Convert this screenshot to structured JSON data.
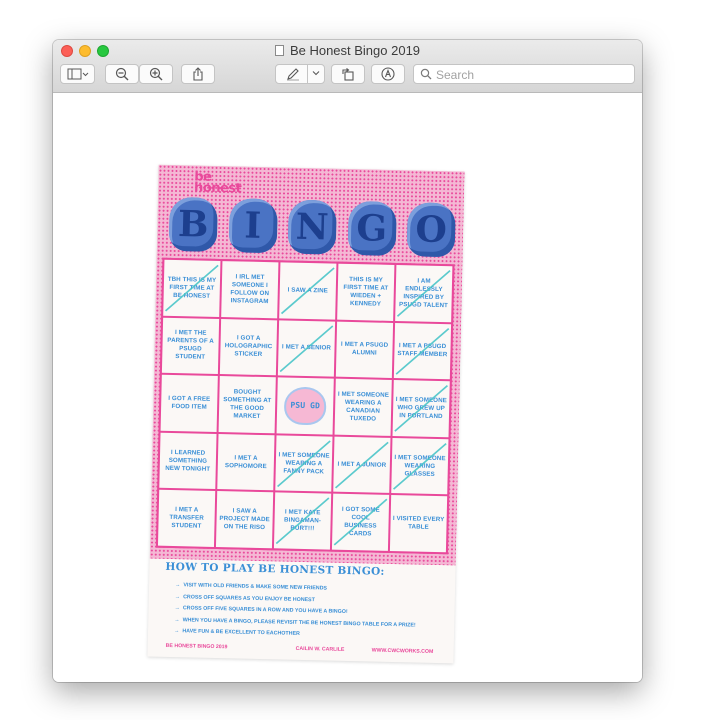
{
  "window": {
    "title": "Be Honest Bingo 2019"
  },
  "toolbar": {
    "sidebar_icon": "sidebar-icon",
    "zoom_out_icon": "zoom-out-icon",
    "zoom_in_icon": "zoom-in-icon",
    "share_icon": "share-icon",
    "markup_icon": "pen-icon",
    "rotate_icon": "rotate-icon",
    "annotate_icon": "markup-icon",
    "search_placeholder": "Search"
  },
  "card": {
    "brand_line1": "be",
    "brand_line2": "honest",
    "letters": [
      "B",
      "I",
      "N",
      "G",
      "O"
    ],
    "squares": [
      {
        "text": "TBH THIS IS MY FIRST TIME AT BE HONEST",
        "crossed": true
      },
      {
        "text": "I IRL MET SOMEONE I FOLLOW ON INSTAGRAM",
        "crossed": false
      },
      {
        "text": "I SAW A ZINE",
        "crossed": true
      },
      {
        "text": "THIS IS MY FIRST TIME AT WIEDEN + KENNEDY",
        "crossed": false
      },
      {
        "text": "I AM ENDLESSLY INSPIRED BY PSUGD TALENT",
        "crossed": true
      },
      {
        "text": "I MET THE PARENTS OF A PSUGD STUDENT",
        "crossed": false
      },
      {
        "text": "I GOT A HOLOGRAPHIC STICKER",
        "crossed": false
      },
      {
        "text": "I MET A SENIOR",
        "crossed": true
      },
      {
        "text": "I MET A PSUGD ALUMNI",
        "crossed": false
      },
      {
        "text": "I MET A PSUGD STAFF MEMBER",
        "crossed": true
      },
      {
        "text": "I GOT A FREE FOOD ITEM",
        "crossed": false
      },
      {
        "text": "BOUGHT SOMETHING AT THE GOOD MARKET",
        "crossed": false
      },
      {
        "text": "PSU GD",
        "crossed": false,
        "free": true
      },
      {
        "text": "I MET SOMEONE WEARING A CANADIAN TUXEDO",
        "crossed": false
      },
      {
        "text": "I MET SOMEONE WHO GREW UP IN PORTLAND",
        "crossed": true
      },
      {
        "text": "I LEARNED SOMETHING NEW TONIGHT",
        "crossed": false
      },
      {
        "text": "I MET A SOPHOMORE",
        "crossed": false
      },
      {
        "text": "I MET SOMEONE WEARING A FANNY PACK",
        "crossed": true
      },
      {
        "text": "I MET A JUNIOR",
        "crossed": true
      },
      {
        "text": "I MET SOMEONE WEARING GLASSES",
        "crossed": true
      },
      {
        "text": "I MET A TRANSFER STUDENT",
        "crossed": false
      },
      {
        "text": "I SAW A PROJECT MADE ON THE RISO",
        "crossed": false
      },
      {
        "text": "I MET KATE BINGAMAN-BURT!!!",
        "crossed": true
      },
      {
        "text": "I GOT SOME COOL BUSINESS CARDS",
        "crossed": true
      },
      {
        "text": "I VISITED EVERY TABLE",
        "crossed": false
      }
    ],
    "howto_title": "HOW TO PLAY BE HONEST BINGO:",
    "rules": [
      "VISIT WITH OLD FRIENDS & MAKE SOME NEW FRIENDS",
      "CROSS OFF SQUARES AS YOU ENJOY BE HONEST",
      "CROSS OFF FIVE SQUARES IN A ROW AND YOU HAVE A BINGO!",
      "WHEN YOU HAVE A BINGO, PLEASE REVISIT THE BE HONEST BINGO TABLE FOR A PRIZE!",
      "HAVE FUN & BE EXCELLENT TO EACHOTHER"
    ],
    "rule_arrow": "→",
    "footer_left": "BE HONEST BINGO 2019",
    "footer_mid": "CAILIN W. CARLILE",
    "footer_right": "WWW.CWCWORKS.COM"
  }
}
